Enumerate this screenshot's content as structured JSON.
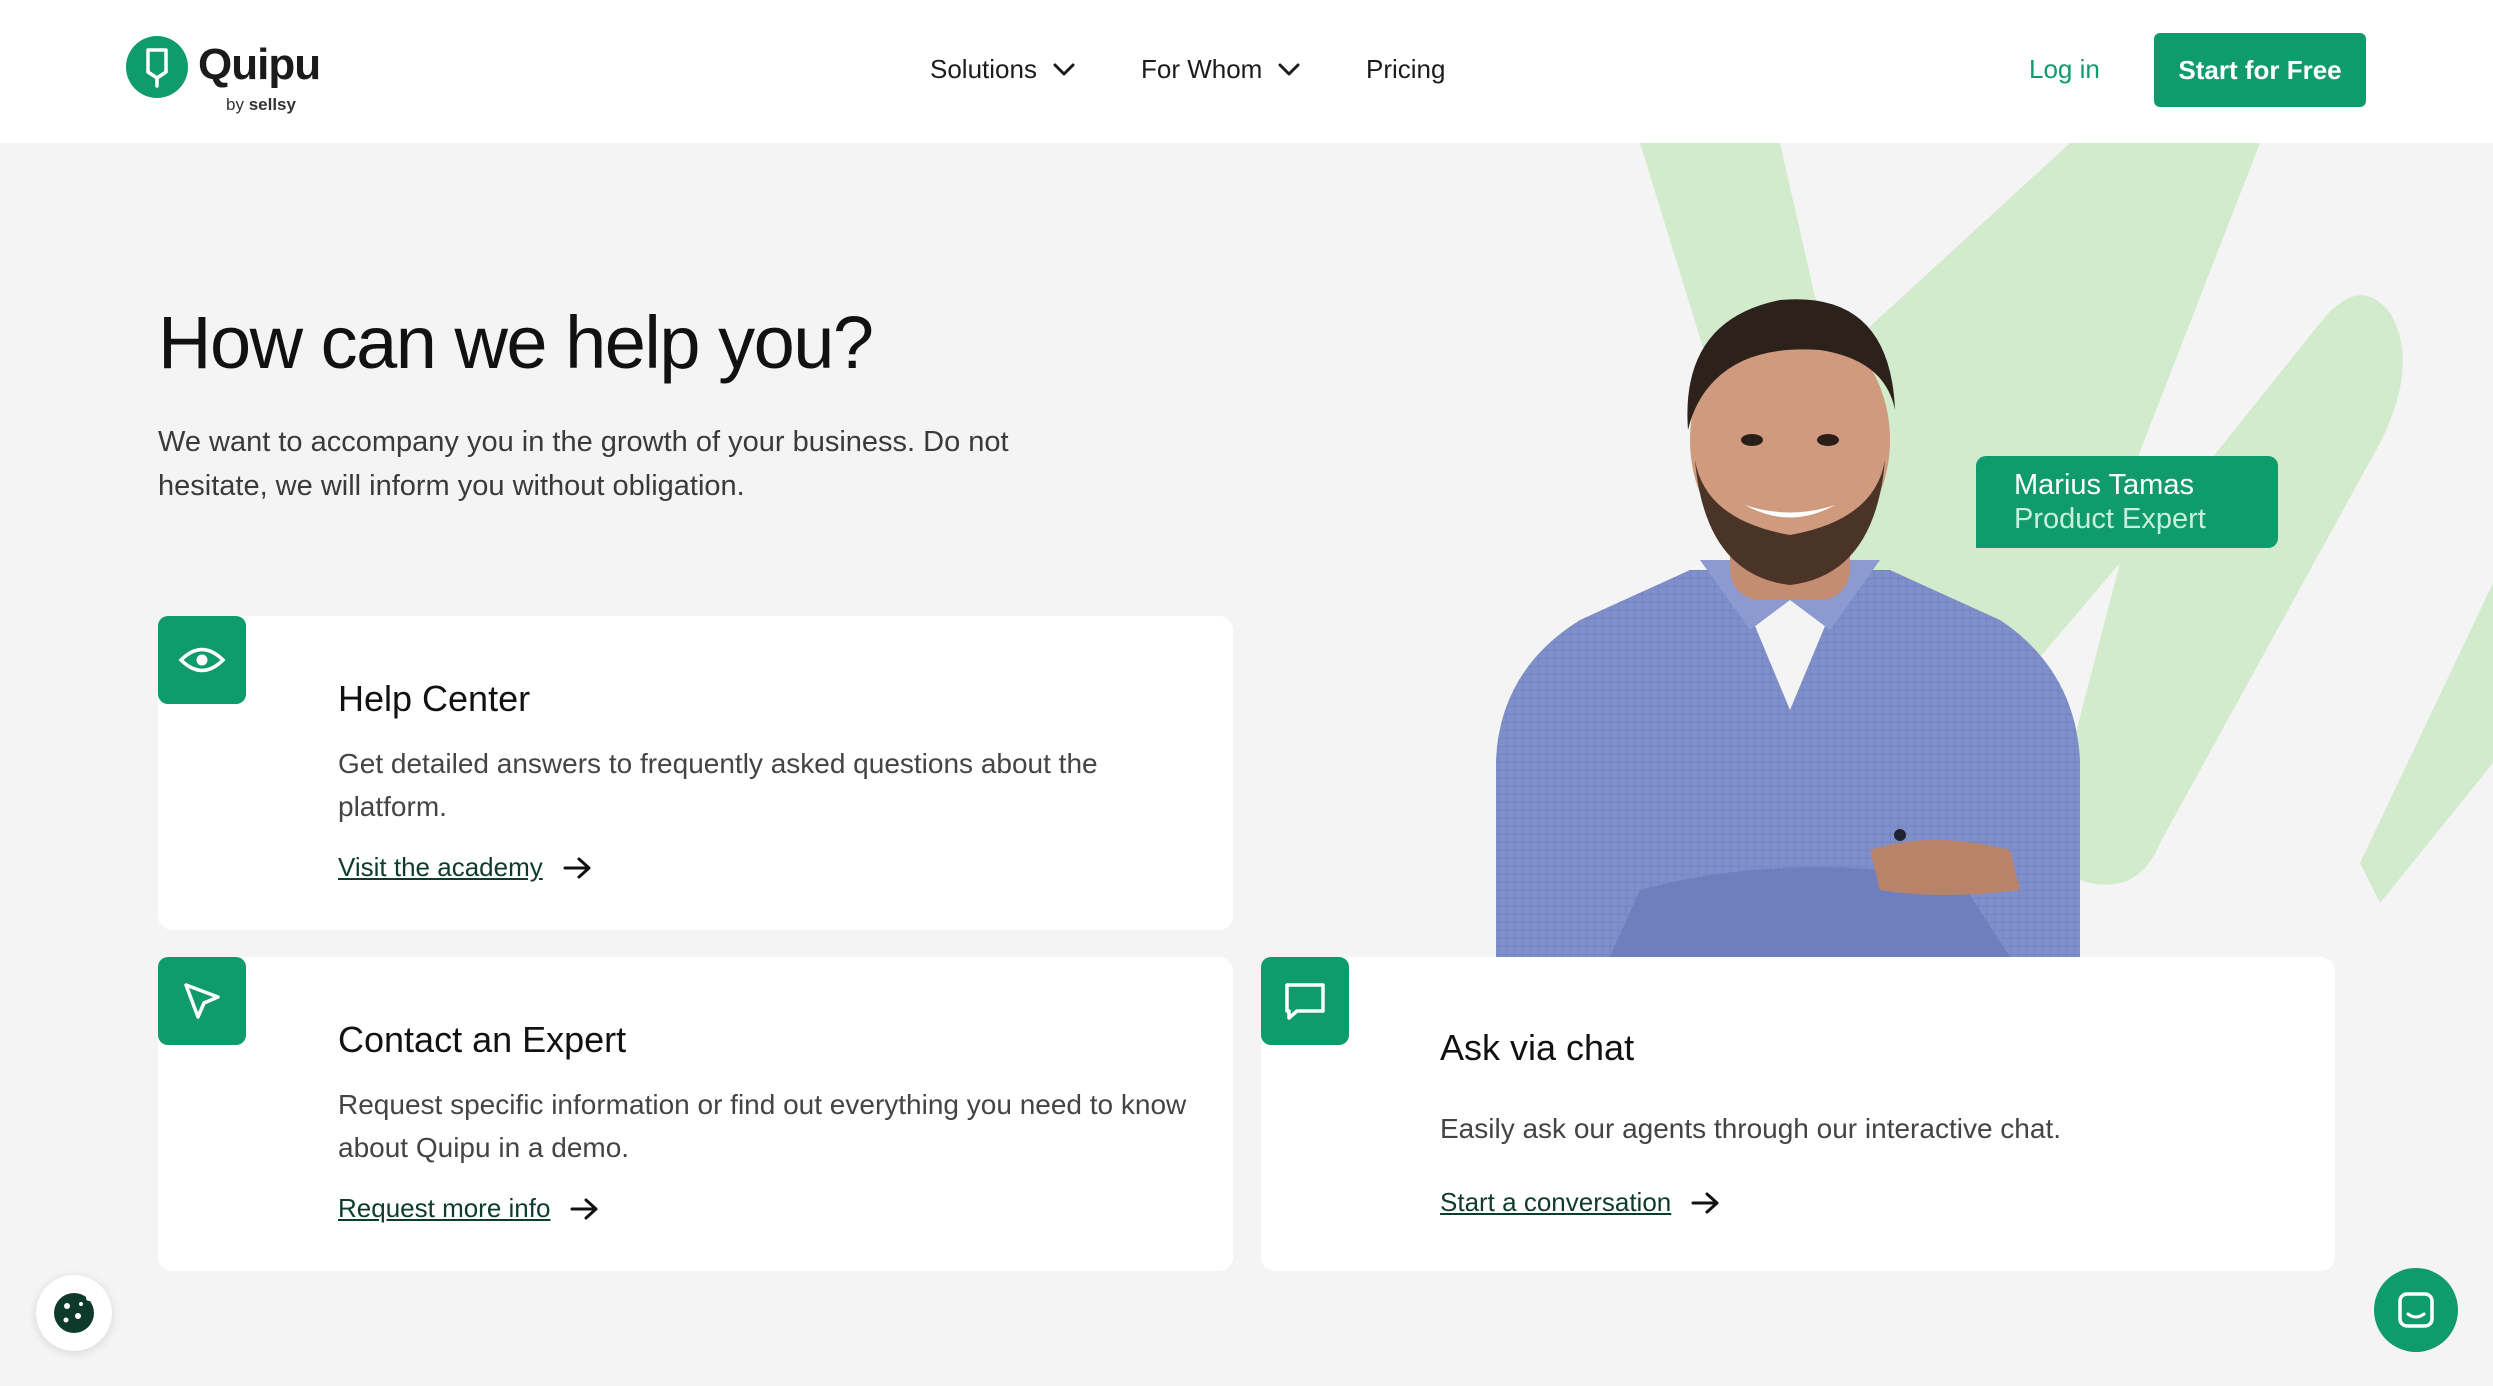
{
  "brand": {
    "name": "Quipu",
    "by_label": "by",
    "by_brand": "sellsy",
    "color": "#0f9b6c",
    "accent_light": "#d3ebcd"
  },
  "nav": {
    "items": [
      {
        "label": "Solutions",
        "has_dropdown": true,
        "icon": "chevron-down-icon"
      },
      {
        "label": "For Whom",
        "has_dropdown": true,
        "icon": "chevron-down-icon"
      },
      {
        "label": "Pricing",
        "has_dropdown": false
      }
    ],
    "login": "Log in",
    "cta": "Start for Free"
  },
  "hero": {
    "title": "How can we help you?",
    "subtitle": "We want to accompany you in the growth of your business. Do not hesitate, we will inform you without obligation."
  },
  "expert": {
    "name": "Marius Tamas",
    "role": "Product Expert"
  },
  "cards": [
    {
      "icon": "eye-icon",
      "title": "Help Center",
      "text": "Get detailed answers to frequently asked questions about the platform.",
      "link": "Visit the academy"
    },
    {
      "icon": "cursor-pointer-icon",
      "title": "Contact an Expert",
      "text": "Request specific information or find out everything you need to know about Quipu in a demo.",
      "link": "Request more info"
    },
    {
      "icon": "chat-bubble-icon",
      "title": "Ask via chat",
      "text": "Easily ask our agents through our interactive chat.",
      "link": "Start a conversation"
    }
  ],
  "floating": {
    "cookie_icon": "cookie-icon",
    "chat_icon": "chat-widget-icon"
  }
}
